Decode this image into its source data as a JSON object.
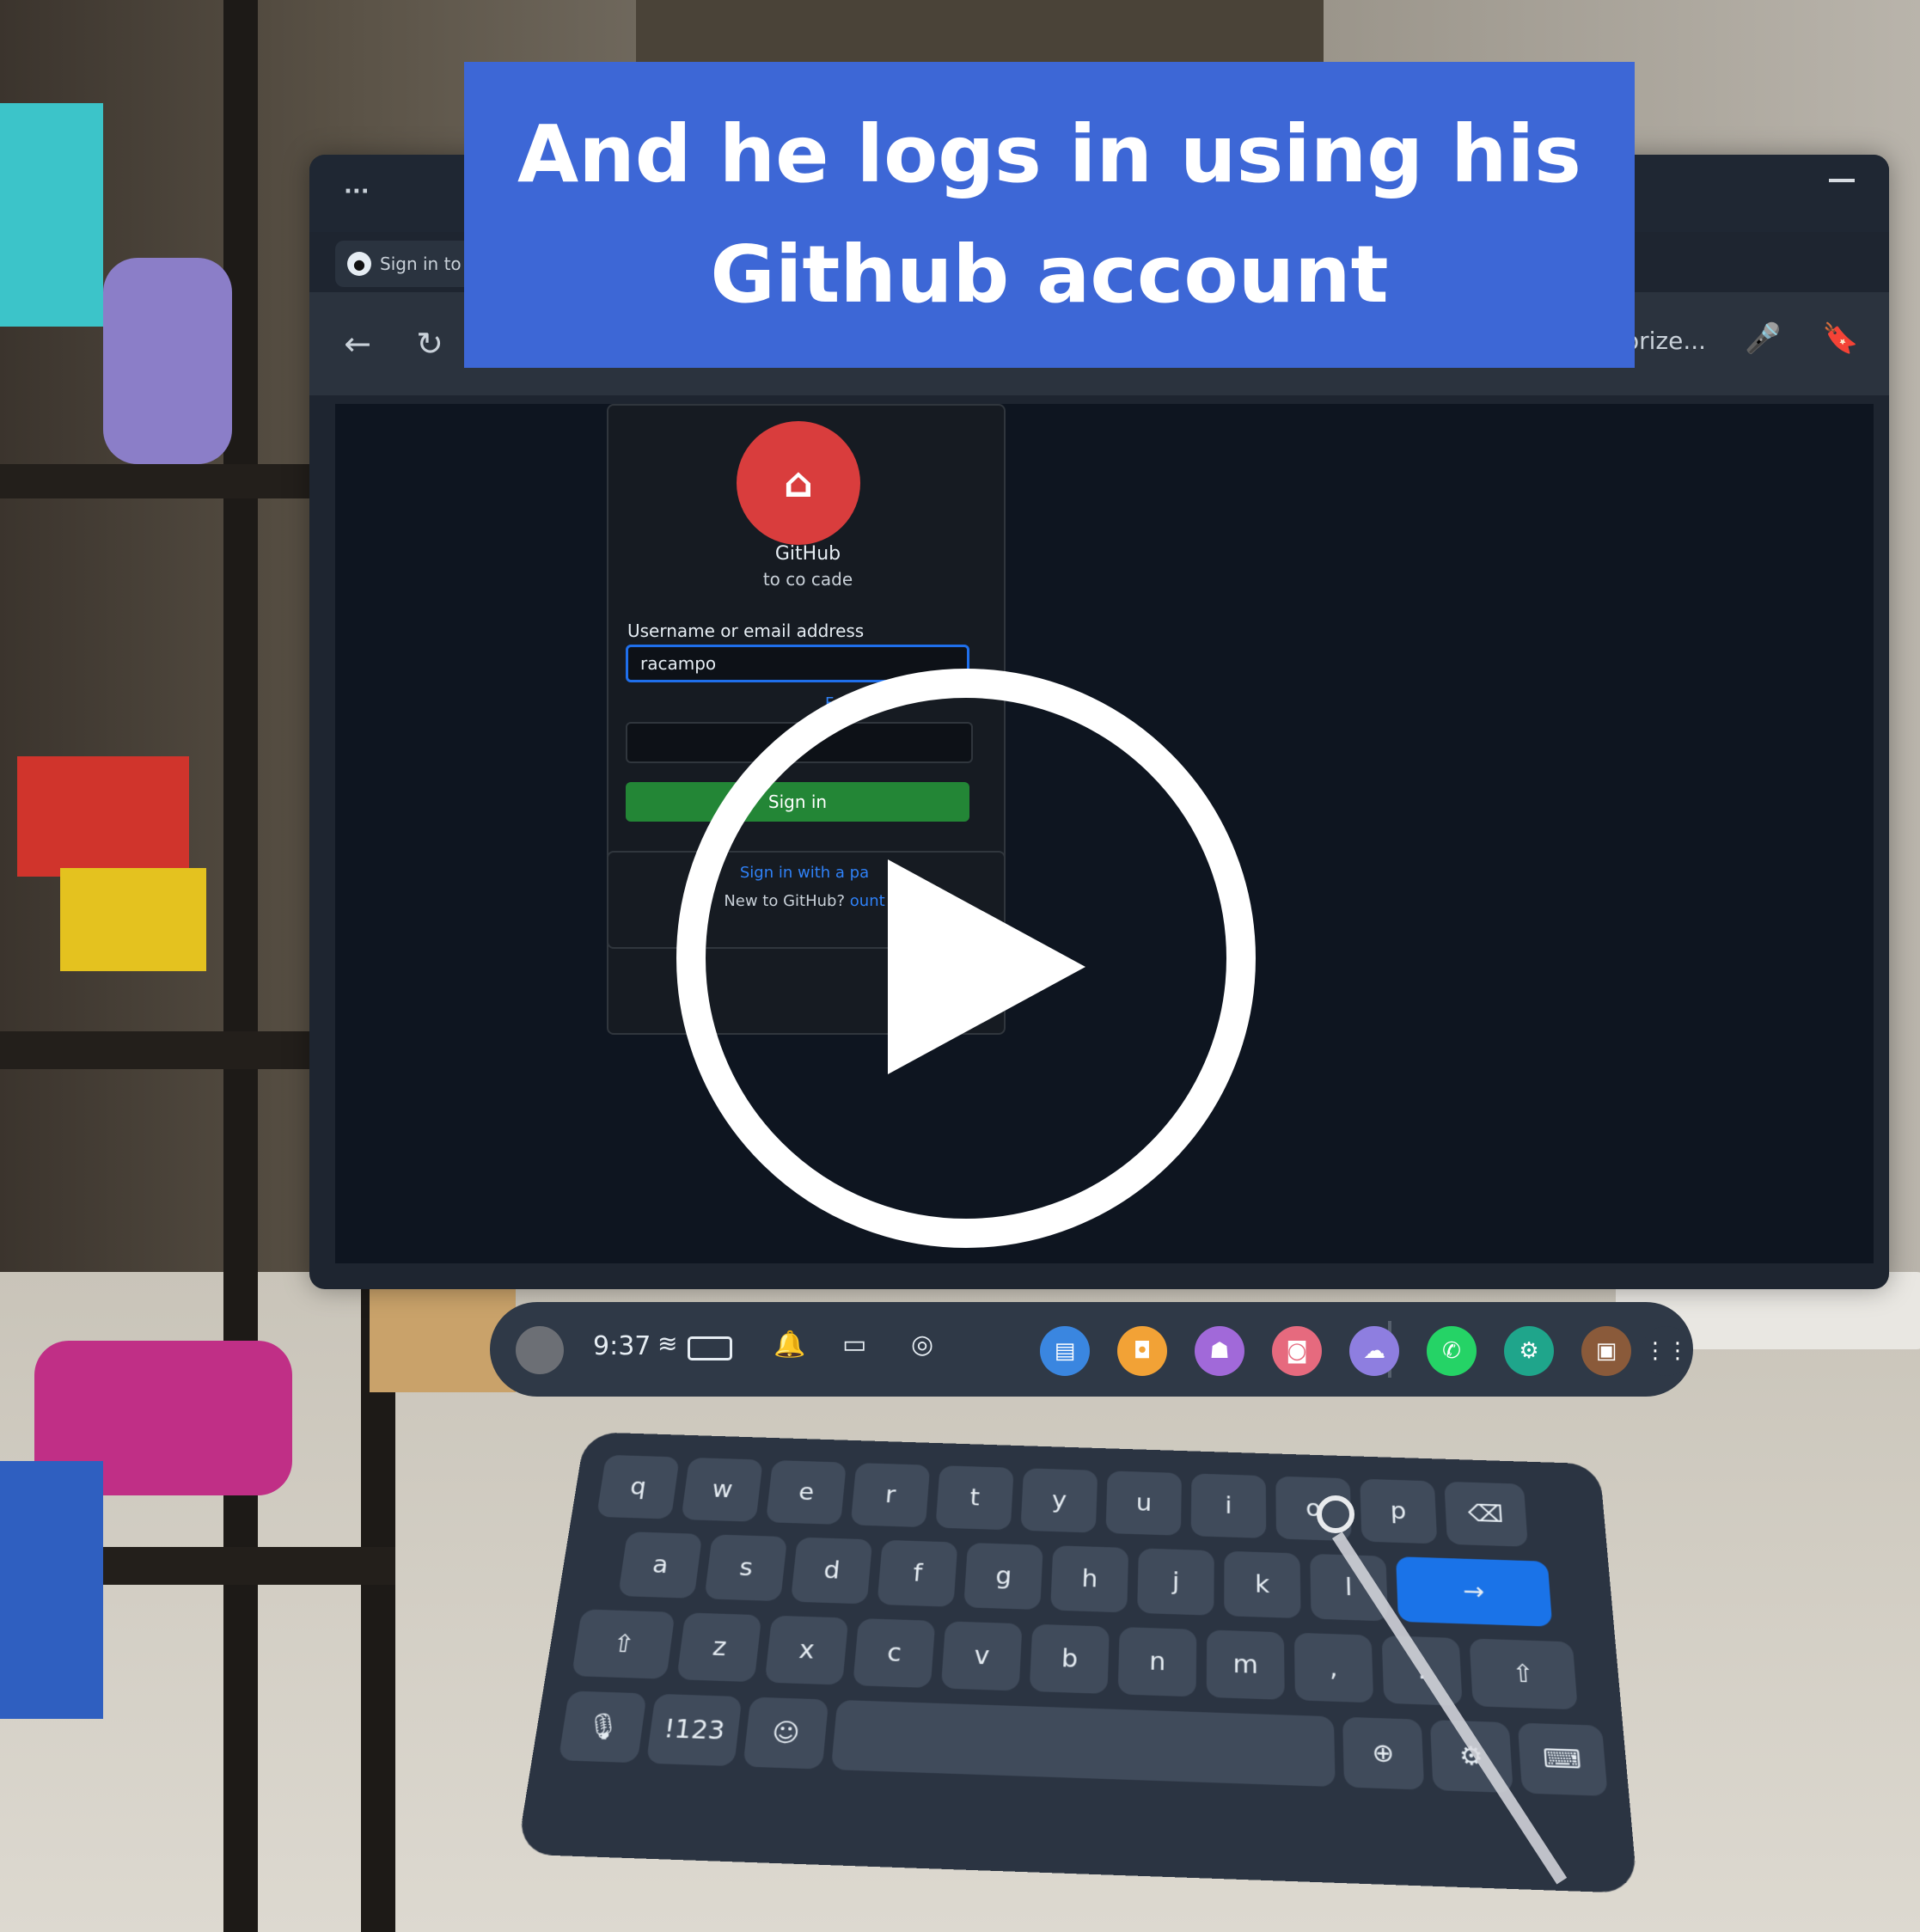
{
  "caption": {
    "line1": "And he logs in using his",
    "line2": "Github account"
  },
  "browser": {
    "menu_dots": "···",
    "tab_title": "Sign in to G",
    "url_fragment": "orize...",
    "back_icon": "back-arrow-icon",
    "reload_icon": "reload-icon",
    "mic_icon": "microphone-icon",
    "bookmark_icon": "bookmark-icon"
  },
  "github": {
    "logo_icon": "github-octocat-icon",
    "sign_in_to": "GitHub",
    "continue_to": "to co",
    "continue_to_app": "cade",
    "username_label": "Username or email address",
    "username_value": "racampo",
    "forgot_link": "Forgo",
    "signin_button": "Sign in",
    "passkey_link": "Sign in with a pa",
    "new_to": "New to GitHub?",
    "create_link": "ount"
  },
  "taskbar": {
    "time": "9:37",
    "wifi_icon": "wifi-icon",
    "battery_icon": "battery-icon",
    "notification_icon": "bell-icon",
    "apps": [
      {
        "name": "app-store",
        "color": "#3a86e0",
        "glyph": "▤"
      },
      {
        "name": "app-bag",
        "color": "#f2a236",
        "glyph": "◘"
      },
      {
        "name": "app-people",
        "color": "#a169d9",
        "glyph": "☗"
      },
      {
        "name": "app-camera",
        "color": "#e66a7e",
        "glyph": "◙"
      },
      {
        "name": "app-chat",
        "color": "#8e7ee0",
        "glyph": "☁"
      },
      {
        "name": "app-whatsapp",
        "color": "#25d366",
        "glyph": "✆"
      },
      {
        "name": "app-settings",
        "color": "#1fa58b",
        "glyph": "⚙"
      },
      {
        "name": "app-game",
        "color": "#8a5a3a",
        "glyph": "▣"
      },
      {
        "name": "app-grid",
        "color": "#2f3947",
        "glyph": "⋮⋮"
      }
    ]
  },
  "keyboard": {
    "row1": [
      "q",
      "w",
      "e",
      "r",
      "t",
      "y",
      "u",
      "i",
      "o",
      "p"
    ],
    "row2": [
      "a",
      "s",
      "d",
      "f",
      "g",
      "h",
      "j",
      "k",
      "l"
    ],
    "row3": [
      "z",
      "x",
      "c",
      "v",
      "b",
      "n",
      "m",
      ",",
      "."
    ],
    "numbers_key": "!123",
    "enter_glyph": "→",
    "shift_glyph": "⇧",
    "backspace_glyph": "⌫",
    "emoji_glyph": "☺",
    "globe_glyph": "⊕",
    "settings_glyph": "⚙",
    "mic_glyph": "🎙",
    "hide_glyph": "⌨"
  },
  "colors": {
    "caption_bg": "#3d67d6",
    "signin_green": "#238636",
    "link_blue": "#2f81f7",
    "enter_blue": "#1a73e8"
  }
}
